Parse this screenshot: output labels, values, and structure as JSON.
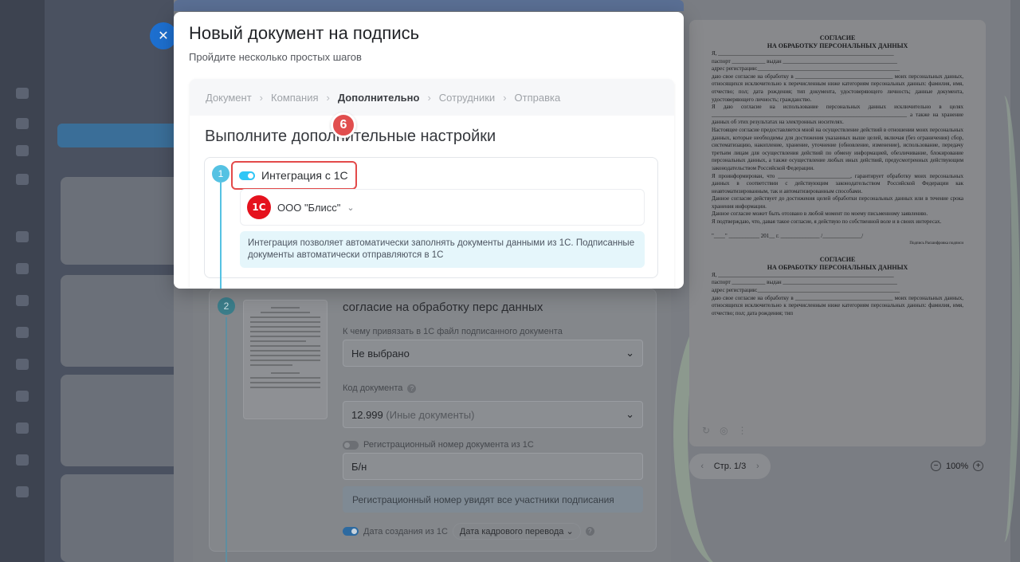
{
  "background": {
    "close_glyph": "✕",
    "step2": {
      "number": "2",
      "doc_title": "согласие на обработку перс данных",
      "bind_label": "К чему привязать в 1С файл подписанного документа",
      "bind_value": "Не выбрано",
      "code_label": "Код документа",
      "code_value": "12.999",
      "code_value_note": "(Иные документы)",
      "reg_toggle_label": "Регистрационный номер документа из 1С",
      "reg_value": "Б/н",
      "reg_info": "Регистрационный номер увидят все участники подписания",
      "date_label": "Дата создания из 1С",
      "date_select": "Дата кадрового перевода"
    },
    "preview": {
      "heading_line1": "СОГЛАСИЕ",
      "heading_line2": "НА ОБРАБОТКУ ПЕРСОНАЛЬНЫХ ДАННЫХ",
      "para1": "Я, _______________________________________________________________",
      "para2": "паспорт ____________ выдан _________________________________________",
      "para3": "адрес регистрации:___________________________________________________",
      "para4": "даю свое согласие на обработку в ___________________________________ моих персональных данных, относящихся исключительно к перечисленным ниже категориям персональных данных: фамилия, имя, отчество; пол; дата рождения; тип документа, удостоверяющего личность; данные документа, удостоверяющего личность; гражданство.",
      "para5": "Я даю согласие на использование персональных данных исключительно в целях ______________________________________________________________________ а также на хранение данных об этих результатах на электронных носителях.",
      "para6": "Настоящее согласие предоставляется мной на осуществление действий в отношении моих персональных данных, которые необходимы для достижения указанных выше целей, включая (без ограничения) сбор, систематизацию, накопление, хранение, уточнение (обновление, изменение), использование, передачу третьим лицам для осуществления действий по обмену информацией, обезличивание, блокирование персональных данных, а также осуществление любых иных действий, предусмотренных действующим законодательством Российской Федерации.",
      "para7": "Я проинформирован, что __________________________, гарантирует обработку моих персональных данных в соответствии с действующим законодательством Российской Федерации как неавтоматизированным, так и автоматизированным способами.",
      "para8": "Данное согласие действует до достижения целей обработки персональных данных или в течение срока хранения информации.",
      "para9": "Данное согласие может быть отозвано в любой момент по моему письменному заявлению.",
      "para10": "Я подтверждаю, что, давая такое согласие, я действую по собственной воле и в своих интересах.",
      "sign_line": "\"____\" ___________ 201__ г.          ______________ /______________/",
      "sign_caption": "Подпись                Расшифровка подписи",
      "heading2_line1": "СОГЛАСИЕ",
      "heading2_line2": "НА ОБРАБОТКУ ПЕРСОНАЛЬНЫХ ДАННЫХ",
      "para11": "Я, _______________________________________________________________",
      "para12": "паспорт ____________ выдан _________________________________________",
      "para13": "адрес регистрации:___________________________________________________",
      "para14": "даю свое согласие на обработку в ___________________________________ моих персональных данных, относящихся исключительно к перечисленным ниже категориям персональных данных: фамилия, имя, отчество; пол; дата рождения; тип"
    },
    "pager": {
      "prev": "‹",
      "label": "Стр. 1/3",
      "next": "›"
    },
    "zoom": {
      "minus": "−",
      "value": "100%",
      "plus": "+"
    }
  },
  "modal": {
    "title": "Новый документ на подпись",
    "subtitle": "Пройдите несколько простых шагов",
    "steps": [
      "Документ",
      "Компания",
      "Дополнительно",
      "Сотрудники",
      "Отправка"
    ],
    "step_separator": "›",
    "section_title": "Выполните дополнительные настройки",
    "step1": {
      "number": "1",
      "integration_label": "Интеграция с 1С",
      "badge": "6",
      "logo_text": "1С",
      "company_name": "ООО \"Блисс\"",
      "chevron": "⌄",
      "info_text": "Интеграция позволяет автоматически заполнять документы данными из 1С. Подписанные документы автоматически отправляются в 1С"
    }
  },
  "colors": {
    "accent_blue": "#2fc6f6",
    "step_blue": "#55c2e3",
    "highlight_red": "#e34a4a",
    "logo_red": "#e5121d",
    "info_bg": "#e5f6fb"
  }
}
